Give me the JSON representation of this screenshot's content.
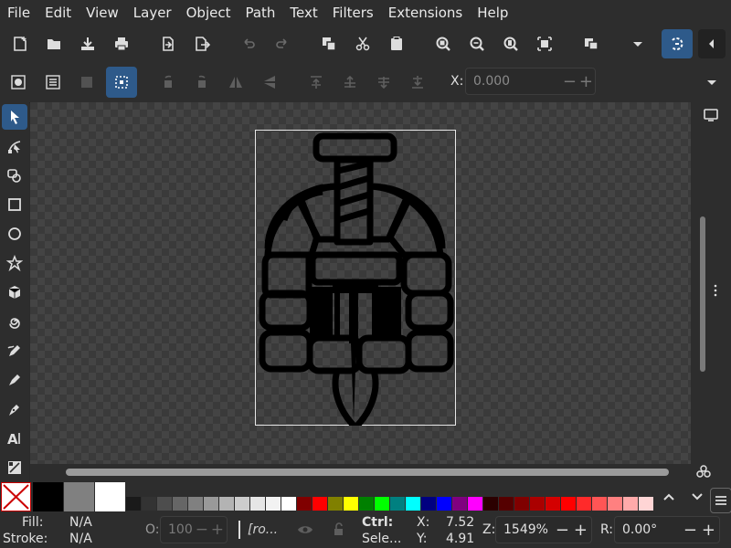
{
  "menu": [
    "File",
    "Edit",
    "View",
    "Layer",
    "Object",
    "Path",
    "Text",
    "Filters",
    "Extensions",
    "Help"
  ],
  "command_bar": {
    "icons": [
      "new-document-icon",
      "open-icon",
      "save-icon",
      "print-icon",
      "import-icon",
      "export-icon",
      "undo-icon",
      "redo-icon",
      "duplicate-icon",
      "cut-icon",
      "paste-icon",
      "zoom-selection-icon",
      "zoom-drawing-icon",
      "zoom-page-icon",
      "zoom-center-icon",
      "clone-icon",
      "dropdown-arrow-icon",
      "snap-toggle-icon",
      "collapse-panel-icon"
    ]
  },
  "tool_controls": {
    "x_label": "X:",
    "x_value": "0.000",
    "minus": "−",
    "plus": "+"
  },
  "toolbox": [
    "selector-tool-icon",
    "node-tool-icon",
    "tweak-tool-icon",
    "rectangle-tool-icon",
    "ellipse-tool-icon",
    "star-tool-icon",
    "3d-box-tool-icon",
    "spiral-tool-icon",
    "pencil-tool-icon",
    "pen-tool-icon",
    "calligraphy-tool-icon",
    "text-tool-icon",
    "gradient-tool-icon"
  ],
  "palette": {
    "none_swatch": "none",
    "big_swatches": [
      "#000000",
      "#808080",
      "#ffffff"
    ],
    "swatches": [
      "#1a1a1a",
      "#333333",
      "#4d4d4d",
      "#666666",
      "#808080",
      "#999999",
      "#b3b3b3",
      "#cccccc",
      "#e6e6e6",
      "#f2f2f2",
      "#ffffff",
      "#800000",
      "#ff0000",
      "#808000",
      "#ffff00",
      "#008000",
      "#00ff00",
      "#008080",
      "#00ffff",
      "#000080",
      "#0000ff",
      "#800080",
      "#ff00ff",
      "#2b0000",
      "#550000",
      "#800000",
      "#aa0000",
      "#d40000",
      "#ff0000",
      "#ff2a2a",
      "#ff5555",
      "#ff8080",
      "#ffaaaa",
      "#ffd5d5"
    ]
  },
  "status": {
    "fill_label": "Fill:",
    "fill_value": "N/A",
    "stroke_label": "Stroke:",
    "stroke_value": "N/A",
    "opacity_label": "O:",
    "opacity_value": "100",
    "layer_text": "[ro...",
    "ctrl_label": "Ctrl:",
    "ctrl_sub": "Sele...",
    "x_label": "X:",
    "x_value": "7.52",
    "y_label": "Y:",
    "y_value": "4.91",
    "zoom_label": "Z:",
    "zoom_value": "1549%",
    "rot_label": "R:",
    "rot_value": "0.00°",
    "minus": "−",
    "plus": "+"
  }
}
